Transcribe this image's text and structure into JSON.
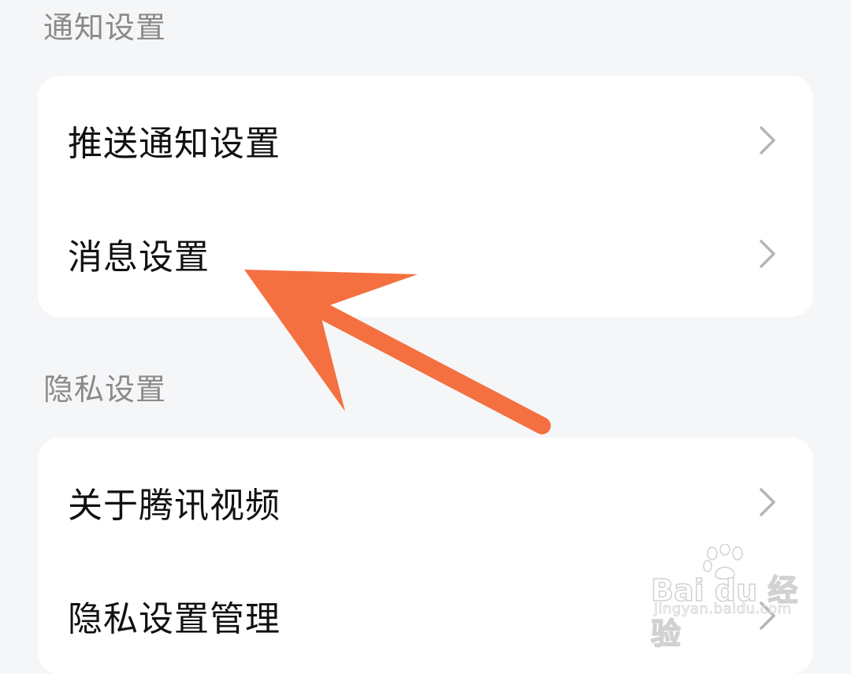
{
  "sections": [
    {
      "title": "通知设置",
      "items": [
        {
          "label": "推送通知设置",
          "icon": "chevron-right-icon"
        },
        {
          "label": "消息设置",
          "icon": "chevron-right-icon"
        }
      ]
    },
    {
      "title": "隐私设置",
      "items": [
        {
          "label": "关于腾讯视频",
          "icon": "chevron-right-icon"
        },
        {
          "label": "隐私设置管理",
          "icon": "chevron-right-icon"
        }
      ]
    }
  ],
  "annotation": {
    "arrow_color": "#f47040",
    "points_to": "消息设置"
  },
  "watermark": {
    "logo_text": "Bai du 经验",
    "url_text": "jingyan.baidu.com"
  },
  "colors": {
    "background": "#f5f6f8",
    "card": "#ffffff",
    "section_title": "#8a8a8a",
    "item_text": "#111111",
    "chevron": "#b5b5b5"
  }
}
